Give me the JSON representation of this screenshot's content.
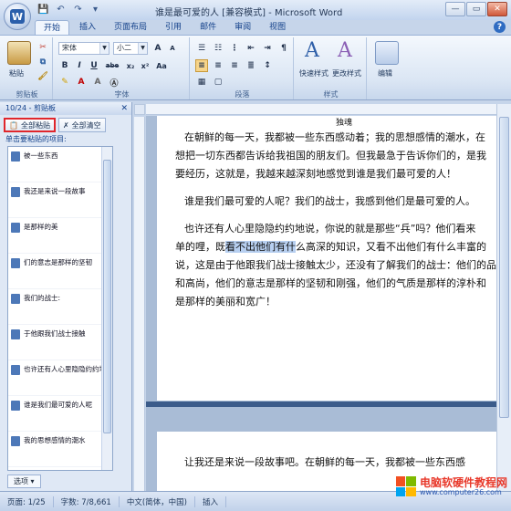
{
  "window": {
    "title": "谁是最可爱的人 [兼容模式] - Microsoft Word"
  },
  "tabs": [
    "开始",
    "插入",
    "页面布局",
    "引用",
    "邮件",
    "审阅",
    "视图"
  ],
  "ribbon": {
    "clipboard": {
      "paste": "粘贴",
      "label": "剪贴板"
    },
    "font": {
      "name": "宋体",
      "size": "小二",
      "label": "字体",
      "bold": "B",
      "italic": "I",
      "underline": "U",
      "strike": "abe",
      "sub": "x₂",
      "sup": "x²",
      "clear": "Aa"
    },
    "paragraph": {
      "label": "段落"
    },
    "styles": {
      "quick": "快速样式",
      "change": "更改样式",
      "label": "样式"
    },
    "editing": {
      "label": "编辑"
    }
  },
  "clipboard_panel": {
    "header": "10/24 - 剪贴板",
    "paste_all": "全部粘贴",
    "clear_all": "全部清空",
    "hint": "单击要粘贴的项目:",
    "items": [
      "被一些东西",
      "我还是来说一段故事",
      "是那样的美",
      "们的意志是那样的坚韧",
      "我们的战士:",
      "于他跟我们战士接触",
      "也许还有人心里隐隐约约地",
      "谁是我们最可爱的人呢",
      "我的思想感情的潮水"
    ],
    "options": "选项"
  },
  "document": {
    "top_fragment": "独魂",
    "lines": [
      "在朝鲜的每一天，我都被一些东西感动着；我的思想感情的潮水，在",
      "想把一切东西都告诉给我祖国的朋友们。但我最急于告诉你们的，是我",
      "要经历，这就是，我越来越深刻地感觉到谁是我们最可爱的人！",
      "谁是我们最可爱的人呢？我们的战士，我感到他们是最可爱的人。",
      "也许还有人心里隐隐约约地说，你说的就是那些“兵”吗？他们看来",
      "单的哩，既",
      "看不出他们有什",
      "么高深的知识，又看不出他们有什么丰富的",
      "说，这是由于他跟我们战士接触太少，还没有了解我们的战士：他们的品",
      "和高尚，他们的意志是那样的坚韧和刚强，他们的气质是那样的淳朴和",
      "是那样的美丽和宽广！"
    ],
    "page2_line": "让我还是来说一段故事吧。在朝鲜的每一天，我都被一些东西感"
  },
  "status": {
    "page": "页面: 1/25",
    "words": "字数: 7/8,661",
    "lang": "中文(简体，中国)",
    "mode": "插入"
  },
  "watermark": {
    "name": "电脑软硬件教程网",
    "url": "www.computer26.com"
  }
}
